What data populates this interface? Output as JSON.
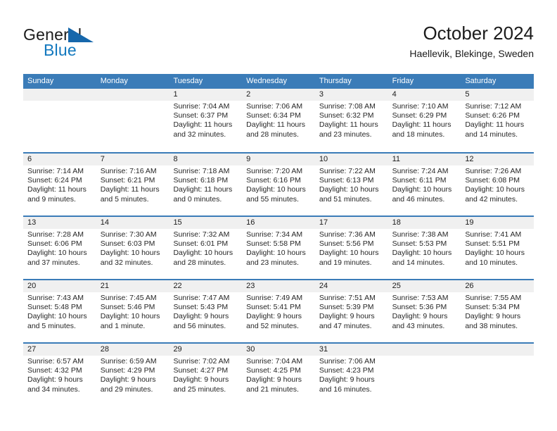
{
  "brand": {
    "name_part1": "General",
    "name_part2": "Blue",
    "triangle_color": "#1667ab",
    "blue_color": "#1278be"
  },
  "header": {
    "title": "October 2024",
    "subtitle": "Haellevik, Blekinge, Sweden"
  },
  "theme": {
    "header_blue": "#3b7cb8",
    "daynum_bg": "#f0f0f0",
    "text": "#262626"
  },
  "calendar": {
    "weekdays": [
      "Sunday",
      "Monday",
      "Tuesday",
      "Wednesday",
      "Thursday",
      "Friday",
      "Saturday"
    ],
    "weeks": [
      [
        {
          "day": "",
          "sunrise": "",
          "sunset": "",
          "daylight": ""
        },
        {
          "day": "",
          "sunrise": "",
          "sunset": "",
          "daylight": ""
        },
        {
          "day": "1",
          "sunrise": "Sunrise: 7:04 AM",
          "sunset": "Sunset: 6:37 PM",
          "daylight": "Daylight: 11 hours and 32 minutes."
        },
        {
          "day": "2",
          "sunrise": "Sunrise: 7:06 AM",
          "sunset": "Sunset: 6:34 PM",
          "daylight": "Daylight: 11 hours and 28 minutes."
        },
        {
          "day": "3",
          "sunrise": "Sunrise: 7:08 AM",
          "sunset": "Sunset: 6:32 PM",
          "daylight": "Daylight: 11 hours and 23 minutes."
        },
        {
          "day": "4",
          "sunrise": "Sunrise: 7:10 AM",
          "sunset": "Sunset: 6:29 PM",
          "daylight": "Daylight: 11 hours and 18 minutes."
        },
        {
          "day": "5",
          "sunrise": "Sunrise: 7:12 AM",
          "sunset": "Sunset: 6:26 PM",
          "daylight": "Daylight: 11 hours and 14 minutes."
        }
      ],
      [
        {
          "day": "6",
          "sunrise": "Sunrise: 7:14 AM",
          "sunset": "Sunset: 6:24 PM",
          "daylight": "Daylight: 11 hours and 9 minutes."
        },
        {
          "day": "7",
          "sunrise": "Sunrise: 7:16 AM",
          "sunset": "Sunset: 6:21 PM",
          "daylight": "Daylight: 11 hours and 5 minutes."
        },
        {
          "day": "8",
          "sunrise": "Sunrise: 7:18 AM",
          "sunset": "Sunset: 6:18 PM",
          "daylight": "Daylight: 11 hours and 0 minutes."
        },
        {
          "day": "9",
          "sunrise": "Sunrise: 7:20 AM",
          "sunset": "Sunset: 6:16 PM",
          "daylight": "Daylight: 10 hours and 55 minutes."
        },
        {
          "day": "10",
          "sunrise": "Sunrise: 7:22 AM",
          "sunset": "Sunset: 6:13 PM",
          "daylight": "Daylight: 10 hours and 51 minutes."
        },
        {
          "day": "11",
          "sunrise": "Sunrise: 7:24 AM",
          "sunset": "Sunset: 6:11 PM",
          "daylight": "Daylight: 10 hours and 46 minutes."
        },
        {
          "day": "12",
          "sunrise": "Sunrise: 7:26 AM",
          "sunset": "Sunset: 6:08 PM",
          "daylight": "Daylight: 10 hours and 42 minutes."
        }
      ],
      [
        {
          "day": "13",
          "sunrise": "Sunrise: 7:28 AM",
          "sunset": "Sunset: 6:06 PM",
          "daylight": "Daylight: 10 hours and 37 minutes."
        },
        {
          "day": "14",
          "sunrise": "Sunrise: 7:30 AM",
          "sunset": "Sunset: 6:03 PM",
          "daylight": "Daylight: 10 hours and 32 minutes."
        },
        {
          "day": "15",
          "sunrise": "Sunrise: 7:32 AM",
          "sunset": "Sunset: 6:01 PM",
          "daylight": "Daylight: 10 hours and 28 minutes."
        },
        {
          "day": "16",
          "sunrise": "Sunrise: 7:34 AM",
          "sunset": "Sunset: 5:58 PM",
          "daylight": "Daylight: 10 hours and 23 minutes."
        },
        {
          "day": "17",
          "sunrise": "Sunrise: 7:36 AM",
          "sunset": "Sunset: 5:56 PM",
          "daylight": "Daylight: 10 hours and 19 minutes."
        },
        {
          "day": "18",
          "sunrise": "Sunrise: 7:38 AM",
          "sunset": "Sunset: 5:53 PM",
          "daylight": "Daylight: 10 hours and 14 minutes."
        },
        {
          "day": "19",
          "sunrise": "Sunrise: 7:41 AM",
          "sunset": "Sunset: 5:51 PM",
          "daylight": "Daylight: 10 hours and 10 minutes."
        }
      ],
      [
        {
          "day": "20",
          "sunrise": "Sunrise: 7:43 AM",
          "sunset": "Sunset: 5:48 PM",
          "daylight": "Daylight: 10 hours and 5 minutes."
        },
        {
          "day": "21",
          "sunrise": "Sunrise: 7:45 AM",
          "sunset": "Sunset: 5:46 PM",
          "daylight": "Daylight: 10 hours and 1 minute."
        },
        {
          "day": "22",
          "sunrise": "Sunrise: 7:47 AM",
          "sunset": "Sunset: 5:43 PM",
          "daylight": "Daylight: 9 hours and 56 minutes."
        },
        {
          "day": "23",
          "sunrise": "Sunrise: 7:49 AM",
          "sunset": "Sunset: 5:41 PM",
          "daylight": "Daylight: 9 hours and 52 minutes."
        },
        {
          "day": "24",
          "sunrise": "Sunrise: 7:51 AM",
          "sunset": "Sunset: 5:39 PM",
          "daylight": "Daylight: 9 hours and 47 minutes."
        },
        {
          "day": "25",
          "sunrise": "Sunrise: 7:53 AM",
          "sunset": "Sunset: 5:36 PM",
          "daylight": "Daylight: 9 hours and 43 minutes."
        },
        {
          "day": "26",
          "sunrise": "Sunrise: 7:55 AM",
          "sunset": "Sunset: 5:34 PM",
          "daylight": "Daylight: 9 hours and 38 minutes."
        }
      ],
      [
        {
          "day": "27",
          "sunrise": "Sunrise: 6:57 AM",
          "sunset": "Sunset: 4:32 PM",
          "daylight": "Daylight: 9 hours and 34 minutes."
        },
        {
          "day": "28",
          "sunrise": "Sunrise: 6:59 AM",
          "sunset": "Sunset: 4:29 PM",
          "daylight": "Daylight: 9 hours and 29 minutes."
        },
        {
          "day": "29",
          "sunrise": "Sunrise: 7:02 AM",
          "sunset": "Sunset: 4:27 PM",
          "daylight": "Daylight: 9 hours and 25 minutes."
        },
        {
          "day": "30",
          "sunrise": "Sunrise: 7:04 AM",
          "sunset": "Sunset: 4:25 PM",
          "daylight": "Daylight: 9 hours and 21 minutes."
        },
        {
          "day": "31",
          "sunrise": "Sunrise: 7:06 AM",
          "sunset": "Sunset: 4:23 PM",
          "daylight": "Daylight: 9 hours and 16 minutes."
        },
        {
          "day": "",
          "sunrise": "",
          "sunset": "",
          "daylight": ""
        },
        {
          "day": "",
          "sunrise": "",
          "sunset": "",
          "daylight": ""
        }
      ]
    ]
  }
}
